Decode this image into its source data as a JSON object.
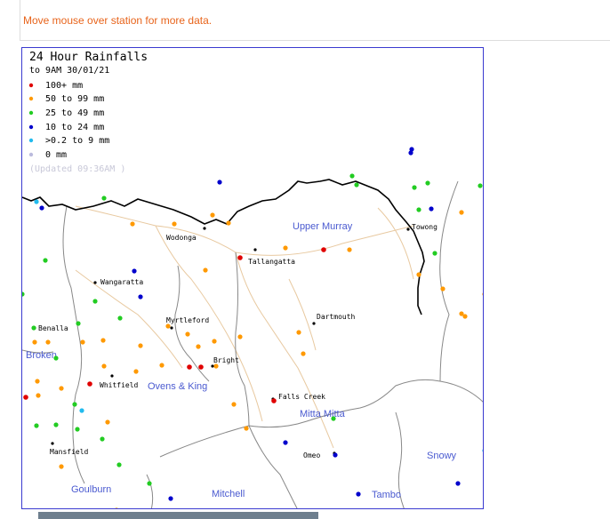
{
  "hint": "Move mouse over station for more data.",
  "map": {
    "title": "24 Hour Rainfalls",
    "subtitle": "to 9AM 30/01/21",
    "updated": "(Updated 09:36AM  )",
    "legend": [
      {
        "label": "100+ mm",
        "color": "#e00000"
      },
      {
        "label": "50  to 99 mm",
        "color": "#ff9900"
      },
      {
        "label": "25  to 49 mm",
        "color": "#22cc22"
      },
      {
        "label": "10  to 24 mm",
        "color": "#0000cc"
      },
      {
        "label": ">0.2 to 9 mm",
        "color": "#22bbee"
      },
      {
        "label": "0 mm",
        "color": "#bbbbdd"
      }
    ],
    "towns": [
      "Wodonga",
      "Tallangatta",
      "Towong",
      "Wangaratta",
      "Myrtleford",
      "Dartmouth",
      "Benalla",
      "Bright",
      "Whitfield",
      "Falls Creek",
      "Mansfield",
      "Omeo"
    ],
    "regions": [
      "Upper Murray",
      "Ovens & King",
      "Mitta Mitta",
      "Broken",
      "Snowy",
      "Goulburn",
      "Mitchell",
      "Tambo"
    ]
  }
}
